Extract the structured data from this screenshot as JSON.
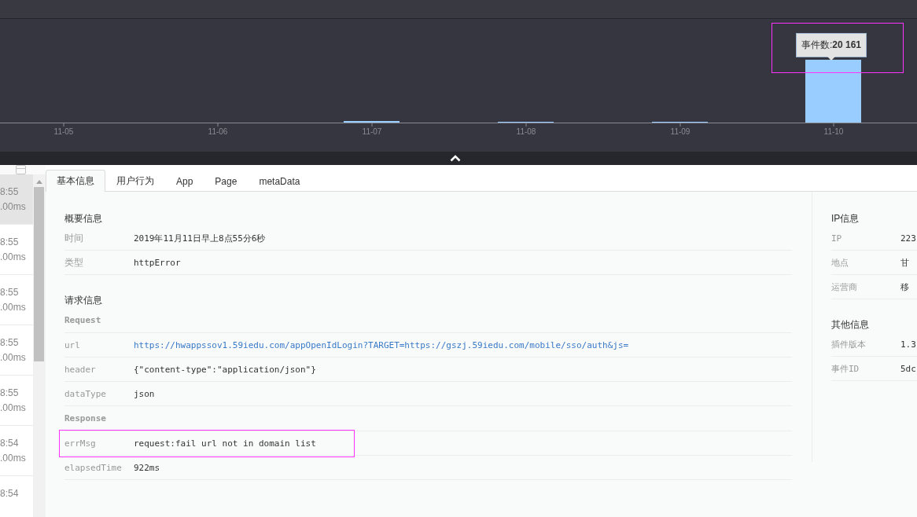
{
  "chart": {
    "x_labels": [
      "11-05",
      "11-06",
      "11-07",
      "11-08",
      "11-09",
      "11-10"
    ],
    "tooltip": "事件数:**20 161**",
    "highlighted": true
  },
  "list": {
    "items": [
      {
        "time": "8:55",
        "duration": ".00ms",
        "selected": true
      },
      {
        "time": "8:55",
        "duration": ".00ms",
        "selected": false
      },
      {
        "time": "8:55",
        "duration": ".00ms",
        "selected": false
      },
      {
        "time": "8:55",
        "duration": ".00ms",
        "selected": false
      },
      {
        "time": "8:55",
        "duration": ".00ms",
        "selected": false
      },
      {
        "time": "8:54",
        "duration": ".00ms",
        "selected": false
      },
      {
        "time": "8:54",
        "selected": false
      }
    ]
  },
  "tabs": [
    {
      "label": "基本信息",
      "selected": true
    },
    {
      "label": "用户行为",
      "selected": false
    },
    {
      "label": "App",
      "selected": false
    },
    {
      "label": "Page",
      "selected": false
    },
    {
      "label": "metaData",
      "selected": false
    }
  ],
  "summary": {
    "title": "概要信息",
    "rows": [
      {
        "label": "时间",
        "value": "2019年11月11日早上8点55分6秒"
      },
      {
        "label": "类型",
        "value": "httpError"
      }
    ]
  },
  "request_info": {
    "title": "请求信息",
    "groups": [
      {
        "title": "Request",
        "rows": [
          {
            "label": "url",
            "value": "https://hwappssov1.59iedu.com/appOpenIdLogin?TARGET=https://gszj.59iedu.com/mobile/sso/auth&js=",
            "kind": "link",
            "highlighted": false
          },
          {
            "label": "header",
            "value": "{\"content-type\":\"application/json\"}",
            "kind": "text",
            "highlighted": false
          },
          {
            "label": "dataType",
            "value": "json",
            "kind": "text",
            "highlighted": false
          }
        ]
      },
      {
        "title": "Response",
        "rows": [
          {
            "label": "errMsg",
            "value": "request:fail url not in domain list",
            "kind": "text",
            "highlighted": true
          },
          {
            "label": "elapsedTime",
            "value": "922ms",
            "kind": "text",
            "highlighted": false
          }
        ]
      }
    ]
  },
  "side": [
    {
      "title": "IP信息",
      "rows": [
        {
          "label": "IP",
          "value": "223"
        },
        {
          "label": "地点",
          "value": "甘"
        },
        {
          "label": "运营商",
          "value": "移"
        }
      ]
    },
    {
      "title": "其他信息",
      "rows": [
        {
          "label": "插件版本",
          "value": "1.3"
        },
        {
          "label": "事件ID",
          "value": "5dc"
        }
      ]
    }
  ]
}
